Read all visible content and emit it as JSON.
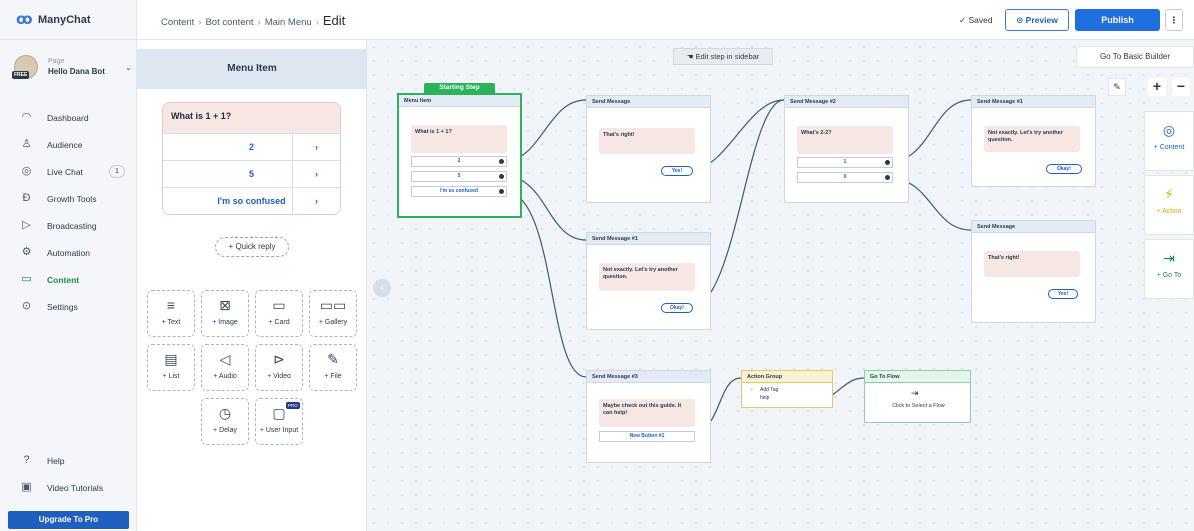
{
  "app": {
    "brand": "ManyChat"
  },
  "sidebar": {
    "page_label": "Page",
    "page_name": "Hello Dana Bot",
    "free_badge": "FREE",
    "items": [
      {
        "label": "Dashboard",
        "icon": "dashboard-icon"
      },
      {
        "label": "Audience",
        "icon": "audience-icon"
      },
      {
        "label": "Live Chat",
        "icon": "chat-icon",
        "count": "1"
      },
      {
        "label": "Growth Tools",
        "icon": "growth-icon"
      },
      {
        "label": "Broadcasting",
        "icon": "broadcast-icon"
      },
      {
        "label": "Automation",
        "icon": "automation-icon"
      },
      {
        "label": "Content",
        "icon": "content-icon",
        "active": true
      },
      {
        "label": "Settings",
        "icon": "settings-icon"
      }
    ],
    "bottom_items": [
      {
        "label": "Help",
        "icon": "help-icon"
      },
      {
        "label": "Video Tutorials",
        "icon": "video-icon"
      }
    ],
    "upgrade": "Upgrade To Pro"
  },
  "topbar": {
    "breadcrumbs": [
      "Content",
      "Bot content",
      "Main Menu"
    ],
    "current": "Edit",
    "saved": "✓ Saved",
    "preview": "Preview",
    "publish": "Publish",
    "more": "⋮"
  },
  "editor": {
    "title": "Menu Item",
    "message": "What is 1 + 1?",
    "replies": [
      "2",
      "5",
      "I'm so confused"
    ],
    "quick_reply": "+ Quick reply",
    "tiles": [
      {
        "label": "+ Text",
        "icon": "text-icon"
      },
      {
        "label": "+ Image",
        "icon": "image-icon"
      },
      {
        "label": "+ Card",
        "icon": "card-icon"
      },
      {
        "label": "+ Gallery",
        "icon": "gallery-icon"
      },
      {
        "label": "+ List",
        "icon": "list-icon"
      },
      {
        "label": "+ Audio",
        "icon": "audio-icon"
      },
      {
        "label": "+ Video",
        "icon": "video-icon"
      },
      {
        "label": "+ File",
        "icon": "file-icon"
      },
      {
        "label": "+ Delay",
        "icon": "delay-icon"
      },
      {
        "label": "+ User Input",
        "icon": "user-input-icon",
        "badge": "PRO"
      }
    ]
  },
  "canvas": {
    "edit_hint": "Edit step in sidebar",
    "basic_builder": "Go To Basic Builder",
    "starting_step": "Starting Step",
    "nodes": {
      "menu": {
        "title": "Menu Item",
        "message": "What is 1 + 1?",
        "buttons": [
          "2",
          "5",
          "I'm so confused"
        ]
      },
      "send1": {
        "title": "Send Message",
        "message": "That's right!",
        "pill": "Yes!"
      },
      "send_alt": {
        "title": "Send Message #1",
        "message": "Not exactly. Let's try another question.",
        "pill": "Okay!"
      },
      "send2": {
        "title": "Send Message #2",
        "message": "What's 2-2?",
        "buttons": [
          "1",
          "0"
        ]
      },
      "send3": {
        "title": "Send Message #3",
        "message": "Maybe check out this guide. It can help!",
        "button": "New Button #1"
      },
      "action": {
        "title": "Action Group",
        "line1": "Add Tag",
        "line2": "help"
      },
      "goflow": {
        "title": "Go To Flow",
        "text": "Click to Select a Flow"
      },
      "r1": {
        "title": "Send Message #1",
        "message": "Not exactly. Let's try another question.",
        "pill": "Okay!"
      },
      "r2": {
        "title": "Send Message",
        "message": "That's right!",
        "pill": "Yes!"
      }
    },
    "side": {
      "content": "+ Content",
      "action": "+ Action",
      "goto": "+ Go To"
    }
  }
}
